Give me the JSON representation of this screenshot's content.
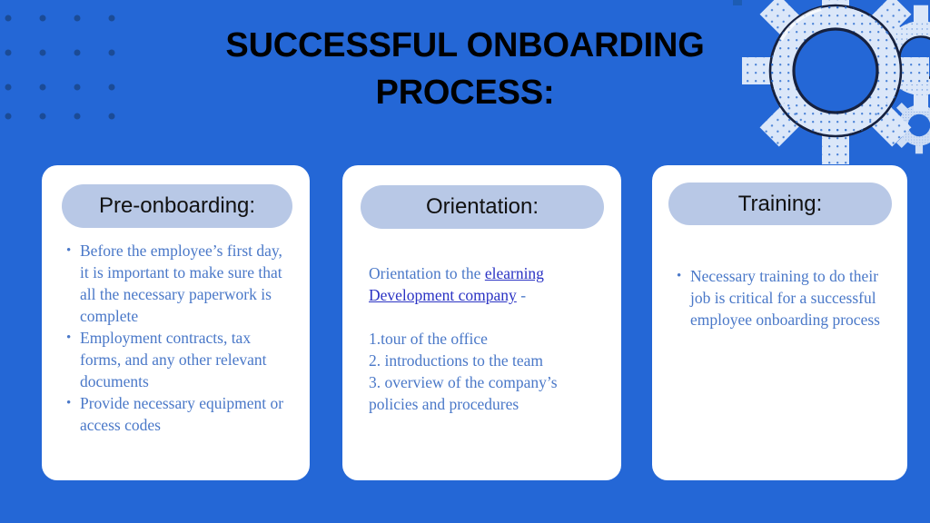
{
  "slide": {
    "background_color": "#2467d6",
    "title": "SUCCESSFUL ONBOARDING PROCESS:"
  },
  "decor": {
    "dot_grid": {
      "name": "dot-grid-pattern",
      "color": "#1b4b96",
      "rows": 4,
      "cols": 4,
      "spacing": 38,
      "radius": 3.5
    },
    "gears": {
      "name": "gear-cluster",
      "light_fill": "#dbe7f9",
      "halftone_dot": "#2f6fd0",
      "outline": "#16213f",
      "dark_gear_fill": "#1d5cb3",
      "center_fill": "#2467d6"
    }
  },
  "cards": [
    {
      "id": "pre-onboarding",
      "heading": "Pre-onboarding:",
      "pill_color": "#b8c8e6",
      "body_type": "bullets",
      "bullets": [
        "Before the employee’s first day, it is important to make sure that all the necessary paperwork is complete",
        "Employment contracts, tax forms, and any other relevant documents",
        "Provide necessary equipment or access codes"
      ]
    },
    {
      "id": "orientation",
      "heading": "Orientation:",
      "pill_color": "#b8c8e6",
      "body_type": "paragraph-and-list",
      "intro_prefix": "Orientation to the ",
      "intro_link": "elearning Development company",
      "intro_suffix": " -",
      "link_color": "#2b33c4",
      "numbered_lines": [
        "1.tour of the office",
        "2. introductions to the team",
        "3. overview of the company’s policies and procedures"
      ]
    },
    {
      "id": "training",
      "heading": "Training:",
      "pill_color": "#b8c8e6",
      "body_type": "bullets",
      "bullets": [
        "Necessary training to do their job is critical for a successful employee onboarding process"
      ]
    }
  ],
  "text_colors": {
    "title": "#000000",
    "heading": "#111111",
    "body": "#4a78c8"
  }
}
